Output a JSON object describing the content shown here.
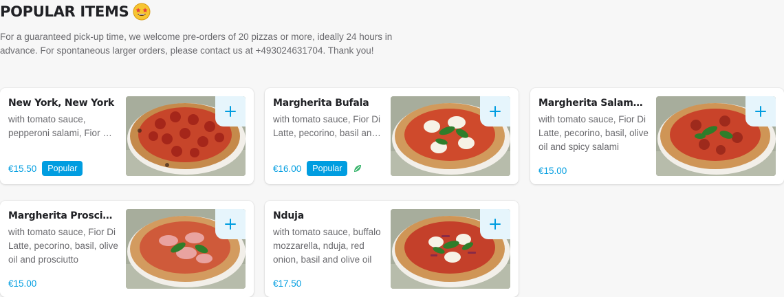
{
  "section": {
    "title": "POPULAR ITEMS",
    "emoji": "star-struck-emoji",
    "intro": "For a guaranteed pick-up time, we welcome pre-orders of 20 pizzas or more, ideally 24 hours in advance. For spontaneous larger orders, please contact us at +493024631704. Thank you!"
  },
  "items": [
    {
      "name": "New York, New York",
      "description": "with tomato sauce, pepperoni salami, Fior Di Latte, pecorino, basil and olive oil",
      "price": "€15.50",
      "badge": "Popular",
      "vegetarian": false,
      "image_icon": "pepperoni-pizza-photo"
    },
    {
      "name": "Margherita Bufala",
      "description": "with tomato sauce, Fior Di Latte, pecorino, basil and olive oil",
      "price": "€16.00",
      "badge": "Popular",
      "vegetarian": true,
      "image_icon": "margherita-pizza-photo"
    },
    {
      "name": "Margherita Salame Piccante",
      "description": "with tomato sauce, Fior Di Latte, pecorino, basil, olive oil and spicy salami",
      "price": "€15.00",
      "badge": "",
      "vegetarian": false,
      "image_icon": "salami-pizza-photo"
    },
    {
      "name": "Margherita Prosciutto",
      "description": "with tomato sauce, Fior Di Latte, pecorino, basil, olive oil and prosciutto",
      "price": "€15.00",
      "badge": "",
      "vegetarian": false,
      "image_icon": "prosciutto-pizza-photo"
    },
    {
      "name": "Nduja",
      "description": "with tomato sauce, buffalo mozzarella, nduja, red onion, basil and olive oil",
      "price": "€17.50",
      "badge": "",
      "vegetarian": false,
      "image_icon": "nduja-pizza-photo"
    }
  ],
  "colors": {
    "accent": "#009de0",
    "add_button_bg": "#e6f5fc",
    "vegetarian_green": "#35b36a"
  }
}
